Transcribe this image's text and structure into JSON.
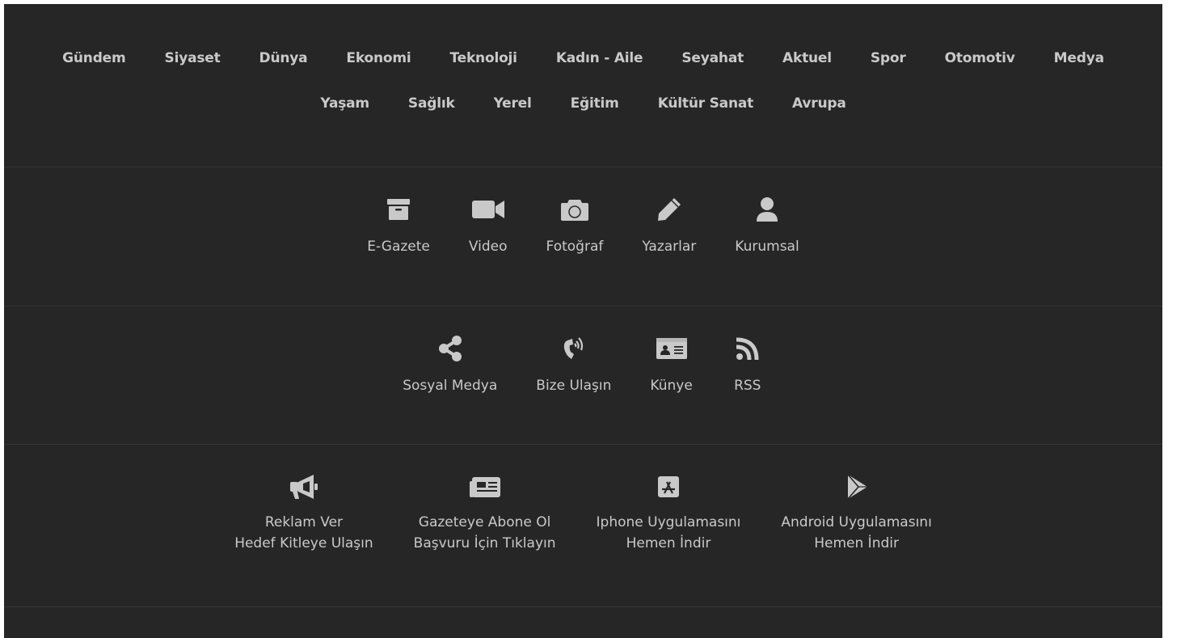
{
  "categories": {
    "row1": [
      "Gündem",
      "Siyaset",
      "Dünya",
      "Ekonomi",
      "Teknoloji",
      "Kadın - Aile",
      "Seyahat",
      "Aktuel",
      "Spor",
      "Otomotiv",
      "Medya"
    ],
    "row2": [
      "Yaşam",
      "Sağlık",
      "Yerel",
      "Eğitim",
      "Kültür Sanat",
      "Avrupa"
    ]
  },
  "quick_links": [
    {
      "label": "E-Gazete",
      "icon": "archive-icon"
    },
    {
      "label": "Video",
      "icon": "video-camera-icon"
    },
    {
      "label": "Fotoğraf",
      "icon": "camera-icon"
    },
    {
      "label": "Yazarlar",
      "icon": "pencil-icon"
    },
    {
      "label": "Kurumsal",
      "icon": "user-icon"
    }
  ],
  "contact_links": [
    {
      "label": "Sosyal Medya",
      "icon": "share-icon"
    },
    {
      "label": "Bize Ulaşın",
      "icon": "phone-volume-icon"
    },
    {
      "label": "Künye",
      "icon": "id-card-icon"
    },
    {
      "label": "RSS",
      "icon": "rss-icon"
    }
  ],
  "promo_links": [
    {
      "line1": "Reklam Ver",
      "line2": "Hedef Kitleye Ulaşın",
      "icon": "megaphone-icon"
    },
    {
      "line1": "Gazeteye Abone Ol",
      "line2": "Başvuru İçin Tıklayın",
      "icon": "newspaper-icon"
    },
    {
      "line1": "Iphone Uygulamasını",
      "line2": "Hemen İndir",
      "icon": "app-store-icon"
    },
    {
      "line1": "Android Uygulamasını",
      "line2": "Hemen İndir",
      "icon": "google-play-icon"
    }
  ],
  "colors": {
    "background": "#262626",
    "text": "#c9c9c9",
    "divider": "#353535"
  }
}
